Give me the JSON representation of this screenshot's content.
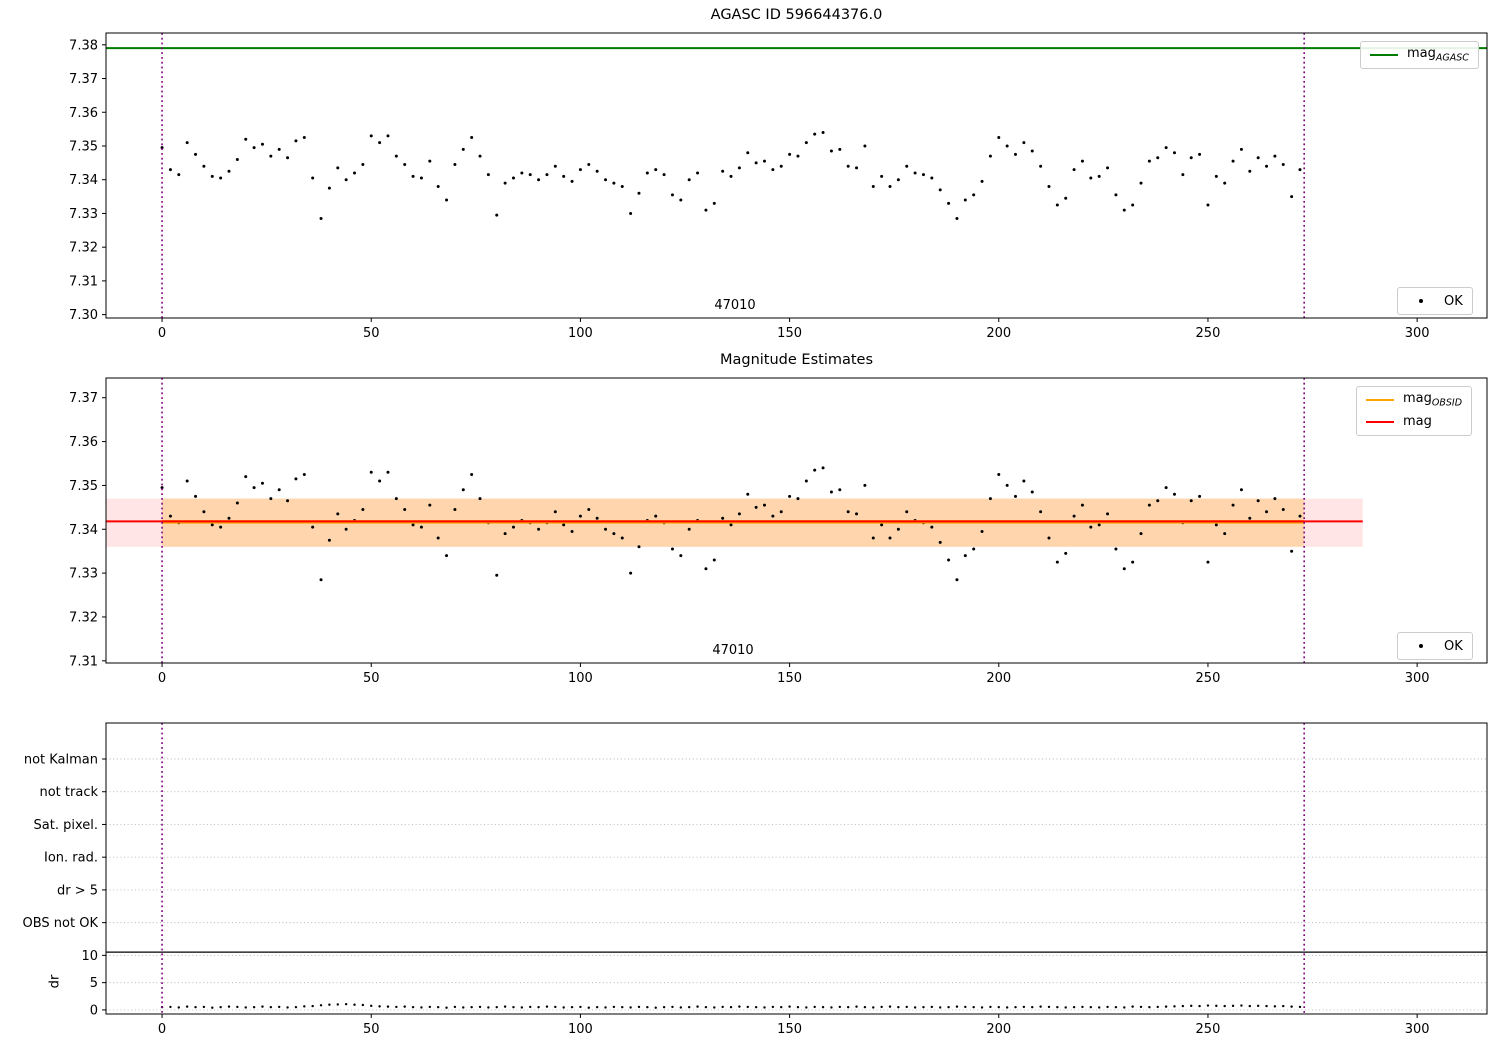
{
  "colors": {
    "agasc_line": "#007d00",
    "mag_line": "#ff0000",
    "obsid_line": "#ffa500",
    "obsid_boundary": "#800080",
    "scatter": "#000000",
    "band_red": "rgba(255,0,0,0.10)",
    "band_orange": "rgba(255,165,0,0.24)",
    "grid": "#b5b5b5",
    "separator": "#000000"
  },
  "plots": {
    "top": {
      "title": "AGASC ID 596644376.0",
      "obsid_label": "47010",
      "ok_label": "OK",
      "legend": {
        "name": "mag",
        "sub": "AGASC"
      }
    },
    "middle": {
      "title": "Magnitude Estimates",
      "obsid_label": "47010",
      "ok_label": "OK",
      "legend": [
        {
          "name": "mag",
          "sub": "OBSID"
        },
        {
          "name": "mag",
          "sub": ""
        }
      ]
    },
    "bottom": {
      "ylabel": "dr"
    }
  },
  "chart_data": [
    {
      "type": "scatter",
      "title": "AGASC ID 596644376.0",
      "xlabel": "",
      "ylabel": "",
      "xlim": [
        -13.4,
        316.7
      ],
      "ylim": [
        7.299,
        7.3835
      ],
      "xticks": [
        0,
        50,
        100,
        150,
        200,
        250,
        300
      ],
      "yticks": [
        {
          "v": 7.3,
          "label": "7.30"
        },
        {
          "v": 7.31,
          "label": "7.31"
        },
        {
          "v": 7.32,
          "label": "7.32"
        },
        {
          "v": 7.33,
          "label": "7.33"
        },
        {
          "v": 7.34,
          "label": "7.34"
        },
        {
          "v": 7.35,
          "label": "7.35"
        },
        {
          "v": 7.36,
          "label": "7.36"
        },
        {
          "v": 7.37,
          "label": "7.37"
        },
        {
          "v": 7.38,
          "label": "7.38"
        }
      ],
      "grid": false,
      "legend_entries": [
        "mag_AGASC",
        "OK"
      ],
      "hlines": [
        {
          "y": 7.379,
          "x0": -13.4,
          "x1": 316.7,
          "color": "#007d00",
          "lw": 2
        }
      ],
      "vlines": [
        0,
        273
      ],
      "annotation": {
        "text": "47010",
        "x": 137,
        "y": 7.3025
      },
      "series": [
        {
          "name": "OK",
          "color": "#000000",
          "r": 1.5,
          "x": [
            0,
            2,
            4,
            6,
            8,
            10,
            12,
            14,
            16,
            18,
            20,
            22,
            24,
            26,
            28,
            30,
            32,
            34,
            36,
            38,
            40,
            42,
            44,
            46,
            48,
            50,
            52,
            54,
            56,
            58,
            60,
            62,
            64,
            66,
            68,
            70,
            72,
            74,
            76,
            78,
            80,
            82,
            84,
            86,
            88,
            90,
            92,
            94,
            96,
            98,
            100,
            102,
            104,
            106,
            108,
            110,
            112,
            114,
            116,
            118,
            120,
            122,
            124,
            126,
            128,
            130,
            132,
            134,
            136,
            138,
            140,
            142,
            144,
            146,
            148,
            150,
            152,
            154,
            156,
            158,
            160,
            162,
            164,
            166,
            168,
            170,
            172,
            174,
            176,
            178,
            180,
            182,
            184,
            186,
            188,
            190,
            192,
            194,
            196,
            198,
            200,
            202,
            204,
            206,
            208,
            210,
            212,
            214,
            216,
            218,
            220,
            222,
            224,
            226,
            228,
            230,
            232,
            234,
            236,
            238,
            240,
            242,
            244,
            246,
            248,
            250,
            252,
            254,
            256,
            258,
            260,
            262,
            264,
            266,
            268,
            270,
            272
          ],
          "y": [
            7.3495,
            7.343,
            7.3415,
            7.351,
            7.3475,
            7.344,
            7.341,
            7.3405,
            7.3425,
            7.346,
            7.352,
            7.3495,
            7.3505,
            7.347,
            7.349,
            7.3465,
            7.3515,
            7.3525,
            7.3405,
            7.3285,
            7.3375,
            7.3435,
            7.34,
            7.342,
            7.3445,
            7.353,
            7.351,
            7.353,
            7.347,
            7.3445,
            7.341,
            7.3405,
            7.3455,
            7.338,
            7.334,
            7.3445,
            7.349,
            7.3525,
            7.347,
            7.3415,
            7.3295,
            7.339,
            7.3405,
            7.342,
            7.3415,
            7.34,
            7.3415,
            7.344,
            7.341,
            7.3395,
            7.343,
            7.3445,
            7.3425,
            7.34,
            7.339,
            7.338,
            7.33,
            7.336,
            7.342,
            7.343,
            7.3415,
            7.3355,
            7.334,
            7.34,
            7.342,
            7.331,
            7.333,
            7.3425,
            7.341,
            7.3435,
            7.348,
            7.345,
            7.3455,
            7.343,
            7.344,
            7.3475,
            7.347,
            7.351,
            7.3535,
            7.354,
            7.3485,
            7.349,
            7.344,
            7.3435,
            7.35,
            7.338,
            7.341,
            7.338,
            7.34,
            7.344,
            7.342,
            7.3415,
            7.3405,
            7.337,
            7.333,
            7.3285,
            7.334,
            7.3355,
            7.3395,
            7.347,
            7.3525,
            7.35,
            7.3475,
            7.351,
            7.3485,
            7.344,
            7.338,
            7.3325,
            7.3345,
            7.343,
            7.3455,
            7.3405,
            7.341,
            7.3435,
            7.3355,
            7.331,
            7.3325,
            7.339,
            7.3455,
            7.3465,
            7.3495,
            7.348,
            7.3415,
            7.3465,
            7.3475,
            7.3325,
            7.341,
            7.339,
            7.3455,
            7.349,
            7.3425,
            7.3465,
            7.344,
            7.347,
            7.3445,
            7.335,
            7.343
          ]
        }
      ]
    },
    {
      "type": "scatter",
      "title": "Magnitude Estimates",
      "xlabel": "",
      "ylabel": "",
      "xlim": [
        -13.4,
        316.7
      ],
      "ylim": [
        7.3095,
        7.3745
      ],
      "xticks": [
        0,
        50,
        100,
        150,
        200,
        250,
        300
      ],
      "yticks": [
        {
          "v": 7.31,
          "label": "7.31"
        },
        {
          "v": 7.32,
          "label": "7.32"
        },
        {
          "v": 7.33,
          "label": "7.33"
        },
        {
          "v": 7.34,
          "label": "7.34"
        },
        {
          "v": 7.35,
          "label": "7.35"
        },
        {
          "v": 7.36,
          "label": "7.36"
        },
        {
          "v": 7.37,
          "label": "7.37"
        }
      ],
      "grid": false,
      "legend_entries": [
        "mag_OBSID",
        "mag",
        "OK"
      ],
      "bands": [
        {
          "x0": -13.4,
          "x1": 287,
          "y0": 7.336,
          "y1": 7.347,
          "color": "rgba(255,0,0,0.10)"
        },
        {
          "x0": 0,
          "x1": 273,
          "y0": 7.336,
          "y1": 7.347,
          "color": "rgba(255,165,0,0.24)"
        }
      ],
      "hlines": [
        {
          "y": 7.3417,
          "x0": 0,
          "x1": 273,
          "color": "#ffa500",
          "lw": 3.5
        },
        {
          "y": 7.3418,
          "x0": -13.4,
          "x1": 287,
          "color": "#ff0000",
          "lw": 2
        }
      ],
      "vlines": [
        0,
        273
      ],
      "annotation": {
        "text": "47010",
        "x": 137,
        "y": 7.3125
      },
      "series": [
        {
          "name": "OK",
          "color": "#000000",
          "r": 1.5,
          "ref": 0
        }
      ]
    },
    {
      "type": "scatter",
      "title": "",
      "xlabel": "",
      "ylabel": "dr",
      "xlim": [
        -13.4,
        316.7
      ],
      "ylim": [
        -0.75,
        52.6
      ],
      "xticks": [
        0,
        50,
        100,
        150,
        200,
        250,
        300
      ],
      "yticks": [
        {
          "v": 46,
          "label": "not Kalman"
        },
        {
          "v": 40,
          "label": "not track"
        },
        {
          "v": 34,
          "label": "Sat. pixel."
        },
        {
          "v": 28,
          "label": "Ion. rad."
        },
        {
          "v": 22,
          "label": "dr > 5"
        },
        {
          "v": 16,
          "label": "OBS not OK"
        },
        {
          "v": 10,
          "label": "10"
        },
        {
          "v": 5,
          "label": "5"
        },
        {
          "v": 0,
          "label": "0"
        }
      ],
      "grid": true,
      "legend_entries": [],
      "hlines": [
        {
          "y": 10.6,
          "x0": -13.4,
          "x1": 316.7,
          "color": "#000000",
          "lw": 1.2
        }
      ],
      "vlines": [
        0,
        273
      ],
      "series": [
        {
          "name": "dr",
          "color": "#000000",
          "r": 1.2,
          "x_ref": 0,
          "y": [
            0.5,
            0.55,
            0.45,
            0.6,
            0.5,
            0.55,
            0.4,
            0.5,
            0.6,
            0.55,
            0.45,
            0.5,
            0.6,
            0.5,
            0.55,
            0.45,
            0.5,
            0.65,
            0.7,
            0.85,
            0.95,
            1.0,
            1.05,
            0.95,
            0.9,
            0.75,
            0.65,
            0.6,
            0.55,
            0.6,
            0.5,
            0.45,
            0.55,
            0.5,
            0.4,
            0.55,
            0.45,
            0.5,
            0.55,
            0.45,
            0.5,
            0.6,
            0.5,
            0.45,
            0.55,
            0.5,
            0.6,
            0.55,
            0.45,
            0.5,
            0.55,
            0.4,
            0.5,
            0.45,
            0.55,
            0.5,
            0.45,
            0.55,
            0.5,
            0.4,
            0.5,
            0.55,
            0.45,
            0.5,
            0.6,
            0.5,
            0.45,
            0.55,
            0.5,
            0.6,
            0.55,
            0.5,
            0.45,
            0.55,
            0.5,
            0.6,
            0.5,
            0.45,
            0.55,
            0.5,
            0.45,
            0.55,
            0.5,
            0.6,
            0.5,
            0.45,
            0.55,
            0.6,
            0.5,
            0.55,
            0.45,
            0.5,
            0.55,
            0.45,
            0.5,
            0.6,
            0.55,
            0.5,
            0.45,
            0.55,
            0.5,
            0.45,
            0.5,
            0.55,
            0.5,
            0.6,
            0.55,
            0.5,
            0.45,
            0.5,
            0.55,
            0.5,
            0.45,
            0.55,
            0.5,
            0.45,
            0.6,
            0.55,
            0.5,
            0.55,
            0.6,
            0.65,
            0.7,
            0.75,
            0.7,
            0.8,
            0.75,
            0.7,
            0.75,
            0.8,
            0.7,
            0.75,
            0.7,
            0.65,
            0.7,
            0.6,
            0.55
          ]
        }
      ]
    }
  ]
}
